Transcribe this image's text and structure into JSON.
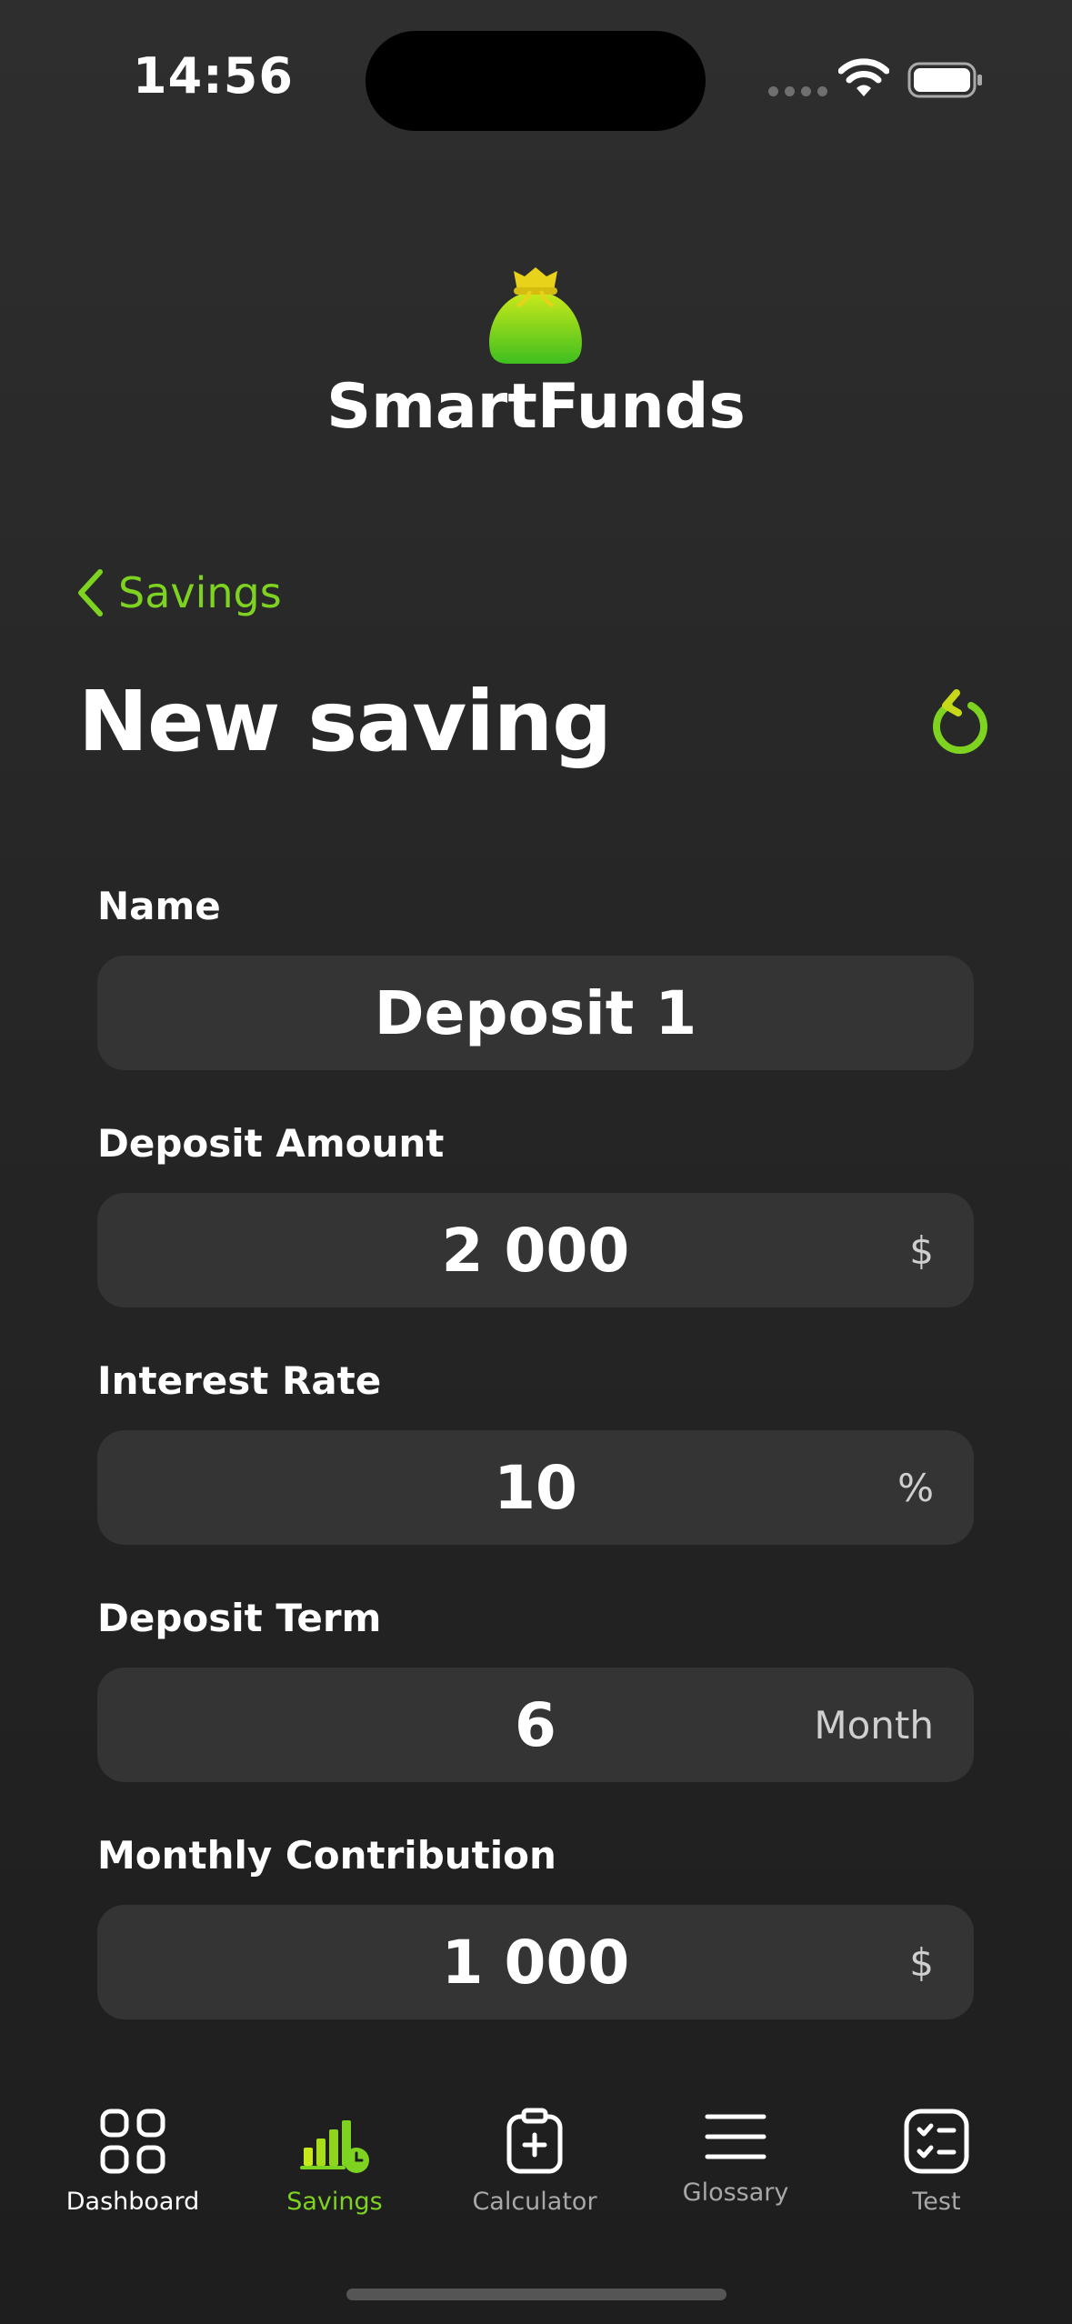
{
  "status_bar": {
    "time": "14:56"
  },
  "app": {
    "name": "SmartFunds"
  },
  "nav": {
    "back_label": "Savings"
  },
  "page": {
    "title": "New saving"
  },
  "form": {
    "fields": [
      {
        "label": "Name",
        "value": "Deposit 1",
        "unit": ""
      },
      {
        "label": "Deposit Amount",
        "value": "2 000",
        "unit": "$"
      },
      {
        "label": "Interest Rate",
        "value": "10",
        "unit": "%"
      },
      {
        "label": "Deposit Term",
        "value": "6",
        "unit": "Month"
      },
      {
        "label": "Monthly Contribution",
        "value": "1 000",
        "unit": "$"
      }
    ]
  },
  "tabs": [
    {
      "label": "Dashboard",
      "icon": "grid-icon"
    },
    {
      "label": "Savings",
      "icon": "savings-chart-icon",
      "active": true
    },
    {
      "label": "Calculator",
      "icon": "clipboard-plus-icon"
    },
    {
      "label": "Glossary",
      "icon": "menu-lines-icon"
    },
    {
      "label": "Test",
      "icon": "checklist-icon"
    }
  ],
  "colors": {
    "accent": "#7ed321",
    "background": "#262626",
    "field": "#343434"
  }
}
